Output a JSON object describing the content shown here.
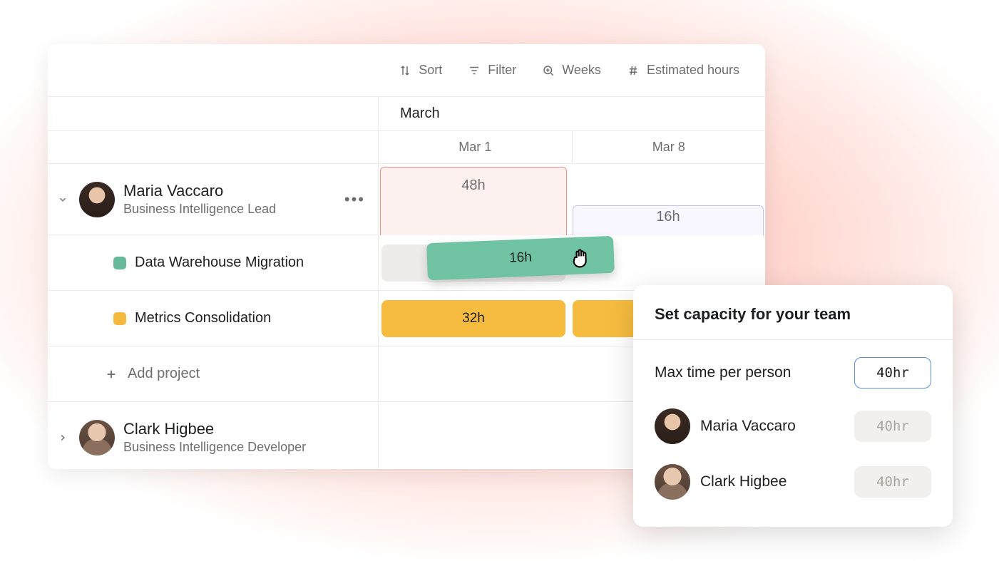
{
  "toolbar": {
    "sort": "Sort",
    "filter": "Filter",
    "weeks": "Weeks",
    "est": "Estimated hours"
  },
  "timeline": {
    "month": "March",
    "weeks": [
      "Mar 1",
      "Mar 8"
    ]
  },
  "people": [
    {
      "name": "Maria Vaccaro",
      "role": "Business Intelligence Lead",
      "caps": [
        {
          "week": 0,
          "hours": "48h",
          "state": "over"
        },
        {
          "week": 1,
          "hours": "16h",
          "state": "under"
        }
      ],
      "projects": [
        {
          "label": "Data Warehouse Migration",
          "color": "#66b99a",
          "bars": [
            {
              "week": 0,
              "hours": "16h",
              "dragging": true
            }
          ]
        },
        {
          "label": "Metrics Consolidation",
          "color": "#f5b93f",
          "bars": [
            {
              "week": 0,
              "hours": "32h"
            },
            {
              "week": 1,
              "hours": ""
            }
          ]
        }
      ]
    },
    {
      "name": "Clark Higbee",
      "role": "Business Intelligence Developer"
    }
  ],
  "add_project": "Add project",
  "popup": {
    "title": "Set capacity for your team",
    "max_label": "Max time per person",
    "max_value": "40hr",
    "people": [
      {
        "name": "Maria Vaccaro",
        "value": "40hr"
      },
      {
        "name": "Clark Higbee",
        "value": "40hr"
      }
    ]
  },
  "colors": {
    "green": "#66b99a",
    "green_bar": "#6fc2a2",
    "yellow": "#f6bc3f",
    "over_border": "#f08f86",
    "over_bg": "#fdf1ef",
    "under_border": "#c9c2f0",
    "under_bg": "#f8f6ff"
  }
}
